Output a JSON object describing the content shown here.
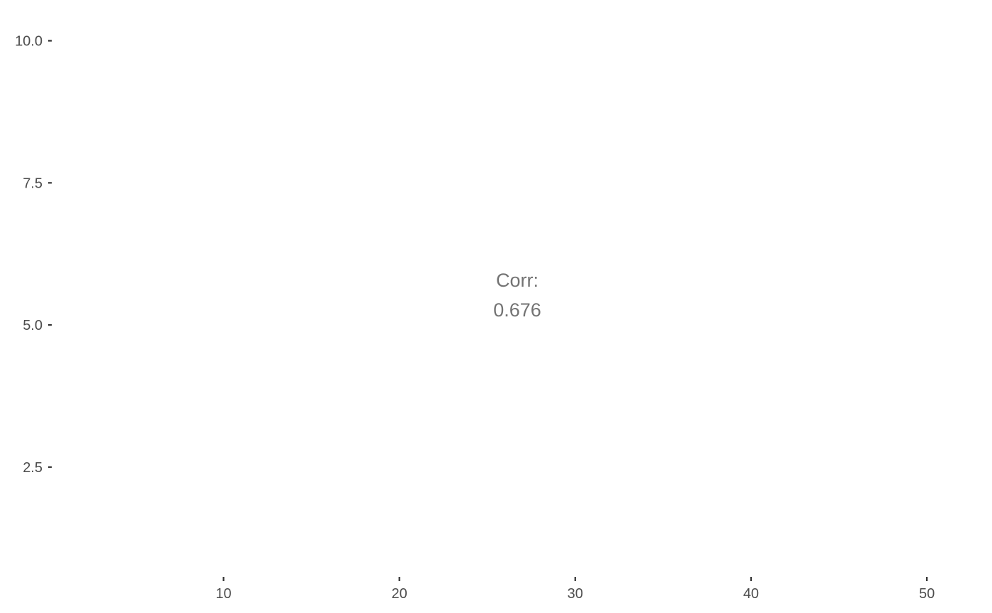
{
  "chart_data": {
    "type": "scatter",
    "title": "",
    "xlabel": "",
    "ylabel": "",
    "x_ticks": [
      10,
      20,
      30,
      40,
      50
    ],
    "x_tick_labels": [
      "10",
      "20",
      "30",
      "40",
      "50"
    ],
    "y_ticks": [
      2.5,
      5.0,
      7.5,
      10.0
    ],
    "y_tick_labels": [
      "2.5",
      "5.0",
      "7.5",
      "10.0"
    ],
    "xlim": [
      0.35,
      53.3
    ],
    "ylim": [
      0.63,
      10.58
    ],
    "grid": false,
    "annotation": {
      "label": "Corr:",
      "value": "0.676"
    }
  }
}
